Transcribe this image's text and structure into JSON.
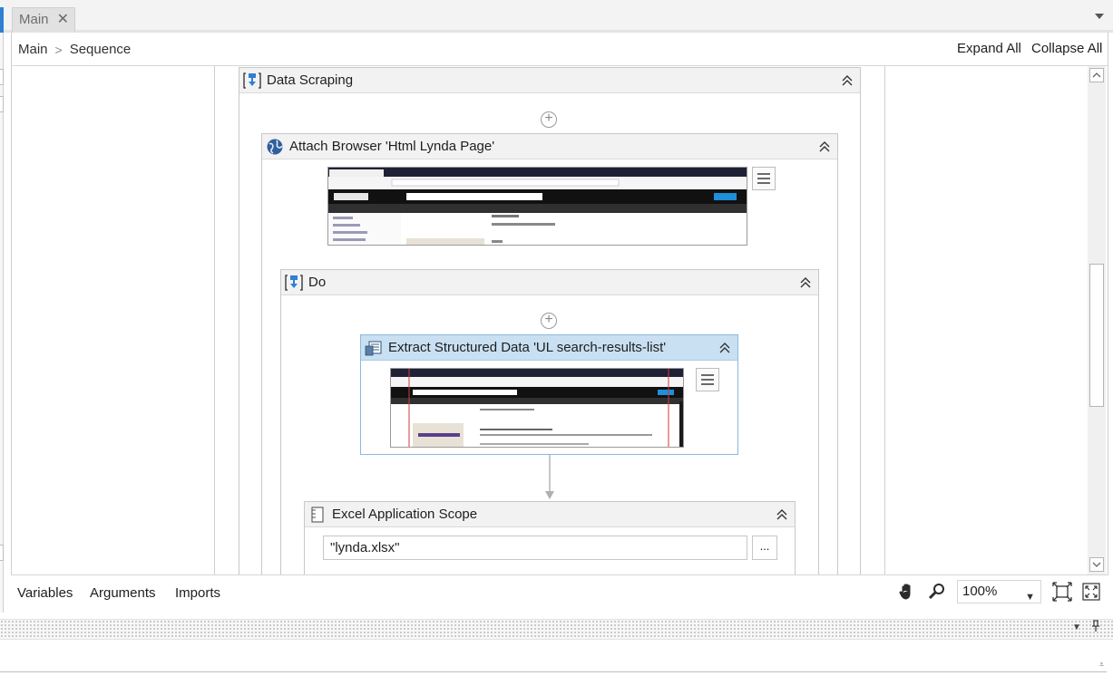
{
  "tab": {
    "label": "Main",
    "close_glyph": "✕"
  },
  "breadcrumb": {
    "items": [
      "Main",
      "Sequence"
    ],
    "separator": ">"
  },
  "header_actions": {
    "expand_all": "Expand All",
    "collapse_all": "Collapse All"
  },
  "activities": {
    "data_scraping": {
      "title": "Data Scraping",
      "icon": "data-scraping-icon"
    },
    "attach_browser": {
      "title": "Attach Browser 'Html Lynda Page'",
      "icon": "globe-icon"
    },
    "do": {
      "title": "Do",
      "icon": "sequence-icon"
    },
    "extract": {
      "title": "Extract Structured Data 'UL  search-results-list'",
      "icon": "table-extract-icon"
    },
    "excel_scope": {
      "title": "Excel Application Scope",
      "icon": "excel-scope-icon",
      "workbook_path": "\"lynda.xlsx\"",
      "browse_label": "..."
    }
  },
  "bottom_tabs": {
    "variables": "Variables",
    "arguments": "Arguments",
    "imports": "Imports"
  },
  "zoom": {
    "value": "100%"
  },
  "tools": [
    "hand-icon",
    "magnifier-icon",
    "fit-to-screen-icon",
    "reset-zoom-icon"
  ],
  "colors": {
    "selected_header": "#c9e0f2",
    "selected_border": "#8ab8e0",
    "accent": "#2f7fd3"
  }
}
